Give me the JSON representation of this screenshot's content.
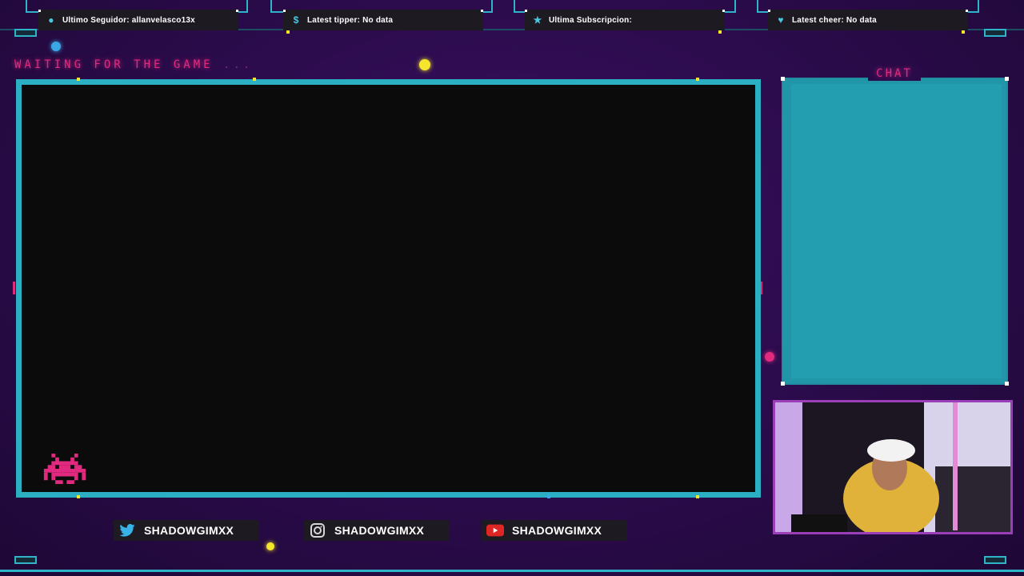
{
  "top_stats": [
    {
      "icon": "user-icon",
      "label": "Ultimo Seguidor: allanvelasco13x"
    },
    {
      "icon": "dollar-icon",
      "label": "Latest tipper: No data"
    },
    {
      "icon": "star-icon",
      "label": "Ultima Subscripcion:"
    },
    {
      "icon": "heart-icon",
      "label": "Latest cheer: No data"
    }
  ],
  "waiting": {
    "text": "WAITING FOR THE GAME",
    "dots": "..."
  },
  "chat": {
    "title": "CHAT"
  },
  "socials": [
    {
      "icon": "twitter-icon",
      "handle": "SHADOWGIMXX"
    },
    {
      "icon": "instagram-icon",
      "handle": "SHADOWGIMXX"
    },
    {
      "icon": "youtube-icon",
      "handle": "SHADOWGIMXX"
    }
  ],
  "colors": {
    "accent_cyan": "#2fb3c9",
    "accent_pink": "#e0297f",
    "accent_yellow": "#f5e52c",
    "bg_purple": "#2a0b4a"
  }
}
